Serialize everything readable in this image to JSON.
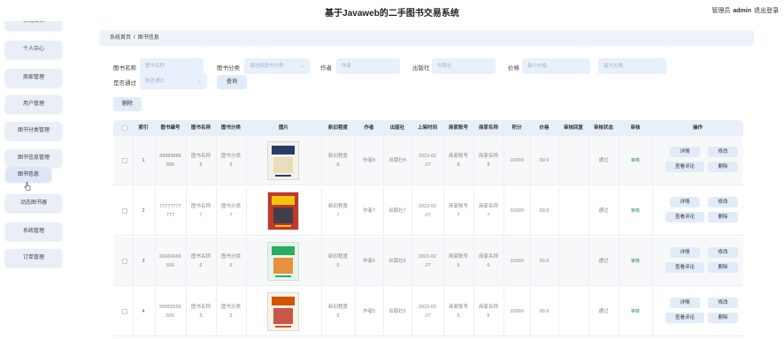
{
  "header": {
    "title": "基于Javaweb的二手图书交易系统",
    "role_label": "管理员",
    "username": "admin",
    "logout_label": "退出登录"
  },
  "sidebar": {
    "items": [
      {
        "label": "系统首页"
      },
      {
        "label": "个人中心"
      },
      {
        "label": "商家管理"
      },
      {
        "label": "用户管理"
      },
      {
        "label": "图书分类管理"
      },
      {
        "label": "图书信息管理"
      },
      {
        "label": "图书信息"
      },
      {
        "label": "动态图书器"
      },
      {
        "label": "系统管理"
      },
      {
        "label": "订单管理"
      }
    ]
  },
  "breadcrumb": {
    "home": "系统首页",
    "current": "图书信息"
  },
  "search": {
    "book_name_label": "图书名称",
    "book_name_placeholder": "图书名称",
    "category_label": "图书分类",
    "category_placeholder": "请选择图书分类",
    "author_label": "作者",
    "author_placeholder": "作者",
    "publisher_label": "出版社",
    "publisher_placeholder": "出版社",
    "price_label": "价格",
    "price_min_placeholder": "最小价格",
    "price_max_placeholder": "最大价格",
    "approved_label": "是否通过",
    "approved_placeholder": "是否通过",
    "query_button": "查询",
    "delete_button": "删除"
  },
  "table": {
    "headers": [
      "索引",
      "图书编号",
      "图书名称",
      "图书分类",
      "图片",
      "新旧程度",
      "作者",
      "出版社",
      "上架时间",
      "商家账号",
      "商家名称",
      "积分",
      "价格",
      "审核回复",
      "审核状态",
      "审核",
      "操作"
    ],
    "actions": {
      "detail": "详情",
      "edit": "修改",
      "view_comments": "查看评论",
      "delete": "删除"
    },
    "rows": [
      {
        "index": "1",
        "code_a": "88888888",
        "code_b": "888",
        "name_a": "图书名称",
        "name_b": "8",
        "cat_a": "图书分类",
        "cat_b": "8",
        "cond_a": "新旧程度",
        "cond_b": "8",
        "author": "作者8",
        "publisher": "出版社8",
        "date_a": "2023-02",
        "date_b": "-27",
        "acct_a": "商家账号",
        "acct_b": "8",
        "mname_a": "商家名称",
        "mname_b": "8",
        "points": "10000",
        "price": "99.9",
        "status": "通过",
        "audit": "审核"
      },
      {
        "index": "2",
        "code_a": "77777777",
        "code_b": "777",
        "name_a": "图书名称",
        "name_b": "7",
        "cat_a": "图书分类",
        "cat_b": "7",
        "cond_a": "新旧程度",
        "cond_b": "7",
        "author": "作者7",
        "publisher": "出版社7",
        "date_a": "2023-02",
        "date_b": "-27",
        "acct_a": "商家账号",
        "acct_b": "7",
        "mname_a": "商家名称",
        "mname_b": "7",
        "points": "10000",
        "price": "99.9",
        "status": "通过",
        "audit": "审核"
      },
      {
        "index": "3",
        "code_a": "66666666",
        "code_b": "666",
        "name_a": "图书名称",
        "name_b": "6",
        "cat_a": "图书分类",
        "cat_b": "6",
        "cond_a": "新旧程度",
        "cond_b": "6",
        "author": "作者6",
        "publisher": "出版社6",
        "date_a": "2023-02",
        "date_b": "-27",
        "acct_a": "商家账号",
        "acct_b": "6",
        "mname_a": "商家名称",
        "mname_b": "6",
        "points": "10000",
        "price": "99.9",
        "status": "通过",
        "audit": "审核"
      },
      {
        "index": "4",
        "code_a": "55555555",
        "code_b": "555",
        "name_a": "图书名称",
        "name_b": "5",
        "cat_a": "图书分类",
        "cat_b": "5",
        "cond_a": "新旧程度",
        "cond_b": "5",
        "author": "作者5",
        "publisher": "出版社5",
        "date_a": "2023-02",
        "date_b": "-27",
        "acct_a": "商家账号",
        "acct_b": "5",
        "mname_a": "商家名称",
        "mname_b": "5",
        "points": "10000",
        "price": "99.9",
        "status": "通过",
        "audit": "审核"
      }
    ]
  },
  "colors": {
    "accent": "#dce6f7",
    "status_green": "#2e8b57"
  }
}
